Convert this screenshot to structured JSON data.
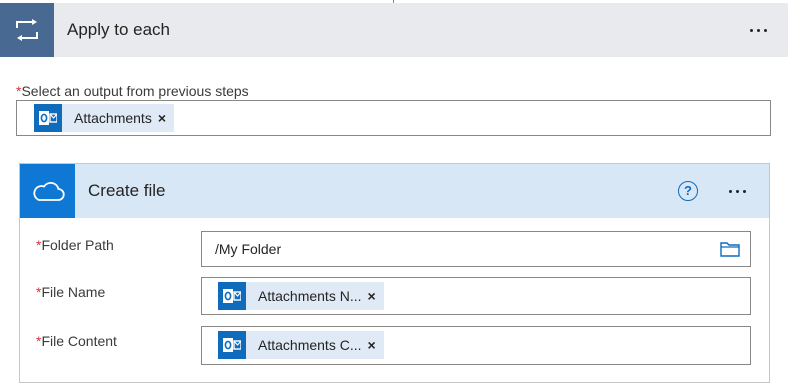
{
  "loop": {
    "title": "Apply to each",
    "icon": "loop-icon",
    "select_label": "Select an output from previous steps",
    "required_marker": "*",
    "token": {
      "label": "Attachments",
      "icon": "outlook-icon",
      "remove": "×"
    }
  },
  "action": {
    "title": "Create file",
    "icon": "onedrive-icon",
    "help": "?",
    "fields": [
      {
        "label": "Folder Path",
        "value": "/My Folder",
        "icon": "folder-icon"
      },
      {
        "label": "File Name",
        "token_label": "Attachments N...",
        "token_icon": "outlook-icon",
        "remove": "×"
      },
      {
        "label": "File Content",
        "token_label": "Attachments C...",
        "token_icon": "outlook-icon",
        "remove": "×"
      }
    ]
  },
  "colors": {
    "loop_header_bg": "#e8eaee",
    "loop_icon_bg": "#486991",
    "card_header_bg": "#d8e7f6",
    "card_icon_bg": "#0f78d4",
    "token_bg": "#dfeaf6",
    "required": "#d13438"
  }
}
